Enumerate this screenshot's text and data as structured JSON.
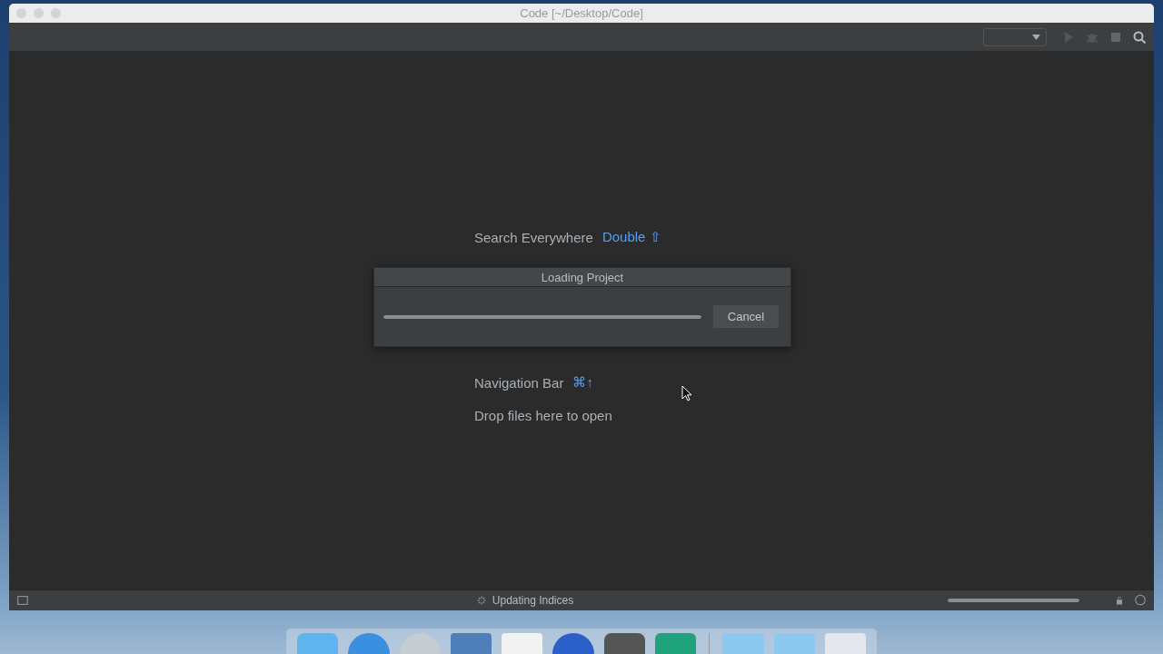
{
  "window": {
    "title": "Code [~/Desktop/Code]"
  },
  "hints": [
    {
      "label": "Search Everywhere",
      "shortcut": "Double ⇧"
    },
    {
      "label": "Navigation Bar",
      "shortcut": "⌘↑"
    },
    {
      "label": "Drop files here to open"
    }
  ],
  "dialog": {
    "title": "Loading Project",
    "button": "Cancel",
    "progress": {
      "level": 1
    }
  },
  "status_bar": {
    "text": "Updating Indices",
    "progress": {
      "level": 1
    }
  }
}
